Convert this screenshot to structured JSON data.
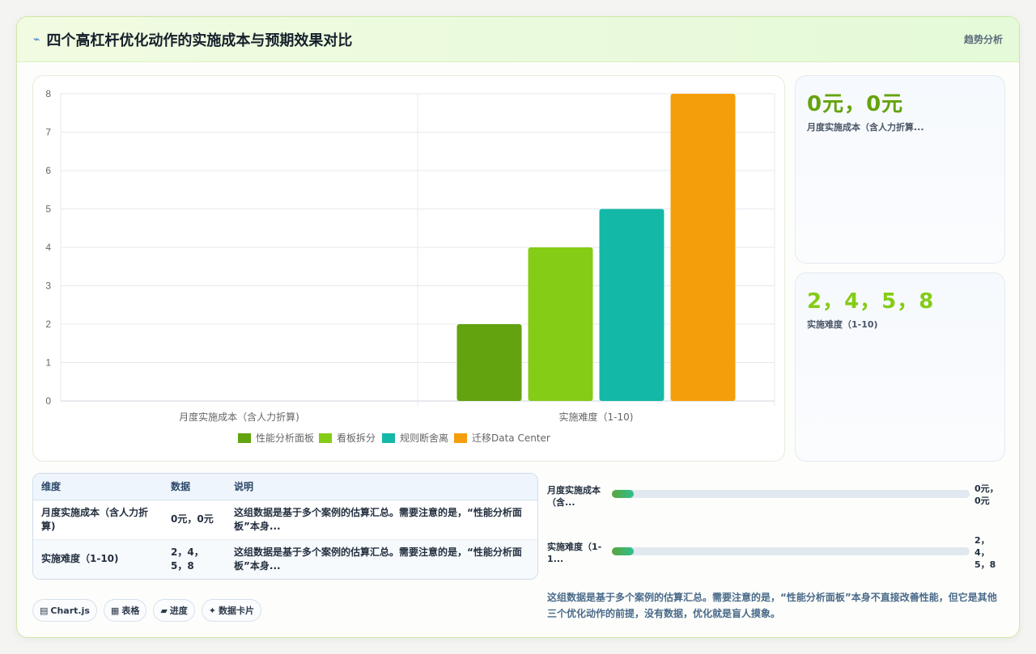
{
  "header": {
    "title": "四个高杠杆优化动作的实施成本与预期效果对比",
    "tag": "趋势分析",
    "icon": "lightning-icon"
  },
  "chart_data": {
    "type": "bar",
    "categories": [
      "月度实施成本（含人力折算)",
      "实施难度（1-10)"
    ],
    "series": [
      {
        "name": "性能分析面板",
        "color": "#62a30f",
        "values": [
          0,
          2
        ]
      },
      {
        "name": "看板拆分",
        "color": "#84cc16",
        "values": [
          0,
          4
        ]
      },
      {
        "name": "规则断舍离",
        "color": "#14b8a6",
        "values": [
          0,
          5
        ]
      },
      {
        "name": "迁移Data Center",
        "color": "#f59e0b",
        "values": [
          0,
          8
        ]
      }
    ],
    "ylim": [
      0,
      8
    ],
    "yticks": [
      "0",
      "1",
      "2",
      "3",
      "4",
      "5",
      "6",
      "7",
      "8"
    ],
    "grid": true,
    "legend": "bottom"
  },
  "stats": [
    {
      "value": "0元，0元",
      "label": "月度实施成本（含人力折算...",
      "color": "#65a30d"
    },
    {
      "value": "2，4，5，8",
      "label": "实施难度（1-10)",
      "color": "#84cc16"
    }
  ],
  "table": {
    "headers": [
      "维度",
      "数据",
      "说明"
    ],
    "rows": [
      [
        "月度实施成本（含人力折算)",
        "0元，0元",
        "这组数据是基于多个案例的估算汇总。需要注意的是，“性能分析面板”本身..."
      ],
      [
        "实施难度（1-10)",
        "2，4，5，8",
        "这组数据是基于多个案例的估算汇总。需要注意的是，“性能分析面板”本身..."
      ]
    ]
  },
  "progress": [
    {
      "label": "月度实施成本（含...",
      "value": "0元，0元",
      "fill_percent": 6
    },
    {
      "label": "实施难度（1-1...",
      "value": "2，4，5，8",
      "fill_percent": 6
    }
  ],
  "note": "这组数据是基于多个案例的估算汇总。需要注意的是，“性能分析面板”本身不直接改善性能，但它是其他三个优化动作的前提，没有数据，优化就是盲人摸象。",
  "chips": [
    {
      "icon": "▤",
      "label": "Chart.js"
    },
    {
      "icon": "▦",
      "label": "表格"
    },
    {
      "icon": "▰",
      "label": "进度"
    },
    {
      "icon": "✦",
      "label": "数据卡片"
    }
  ]
}
